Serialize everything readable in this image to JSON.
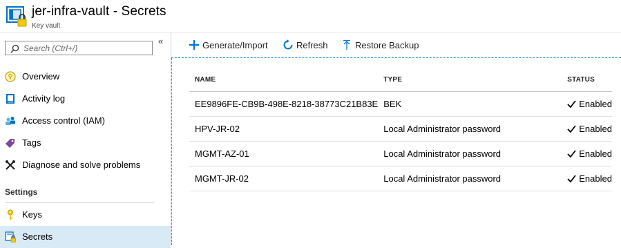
{
  "header": {
    "title": "jer-infra-vault - Secrets",
    "subtitle": "Key vault"
  },
  "sidebar": {
    "collapse_glyph": "«",
    "search_placeholder": "Search (Ctrl+/)",
    "items": [
      {
        "label": "Overview",
        "icon": "overview-icon"
      },
      {
        "label": "Activity log",
        "icon": "activity-log-icon"
      },
      {
        "label": "Access control (IAM)",
        "icon": "access-control-icon"
      },
      {
        "label": "Tags",
        "icon": "tag-icon"
      },
      {
        "label": "Diagnose and solve problems",
        "icon": "wrench-icon"
      }
    ],
    "section_settings": "Settings",
    "settings_items": [
      {
        "label": "Keys",
        "icon": "key-icon"
      },
      {
        "label": "Secrets",
        "icon": "secret-icon",
        "active": true
      }
    ]
  },
  "toolbar": {
    "generate_label": "Generate/Import",
    "refresh_label": "Refresh",
    "restore_label": "Restore Backup"
  },
  "table": {
    "columns": [
      "NAME",
      "TYPE",
      "STATUS"
    ],
    "rows": [
      {
        "name": "EE9896FE-CB9B-498E-8218-38773C21B83E",
        "type": "BEK",
        "status": "Enabled"
      },
      {
        "name": "HPV-JR-02",
        "type": "Local Administrator password",
        "status": "Enabled"
      },
      {
        "name": "MGMT-AZ-01",
        "type": "Local Administrator password",
        "status": "Enabled"
      },
      {
        "name": "MGMT-JR-02",
        "type": "Local Administrator password",
        "status": "Enabled"
      }
    ]
  },
  "colors": {
    "accent": "#0078d4",
    "active_nav": "#d9eaf7",
    "lock_yellow": "#f2c811"
  }
}
